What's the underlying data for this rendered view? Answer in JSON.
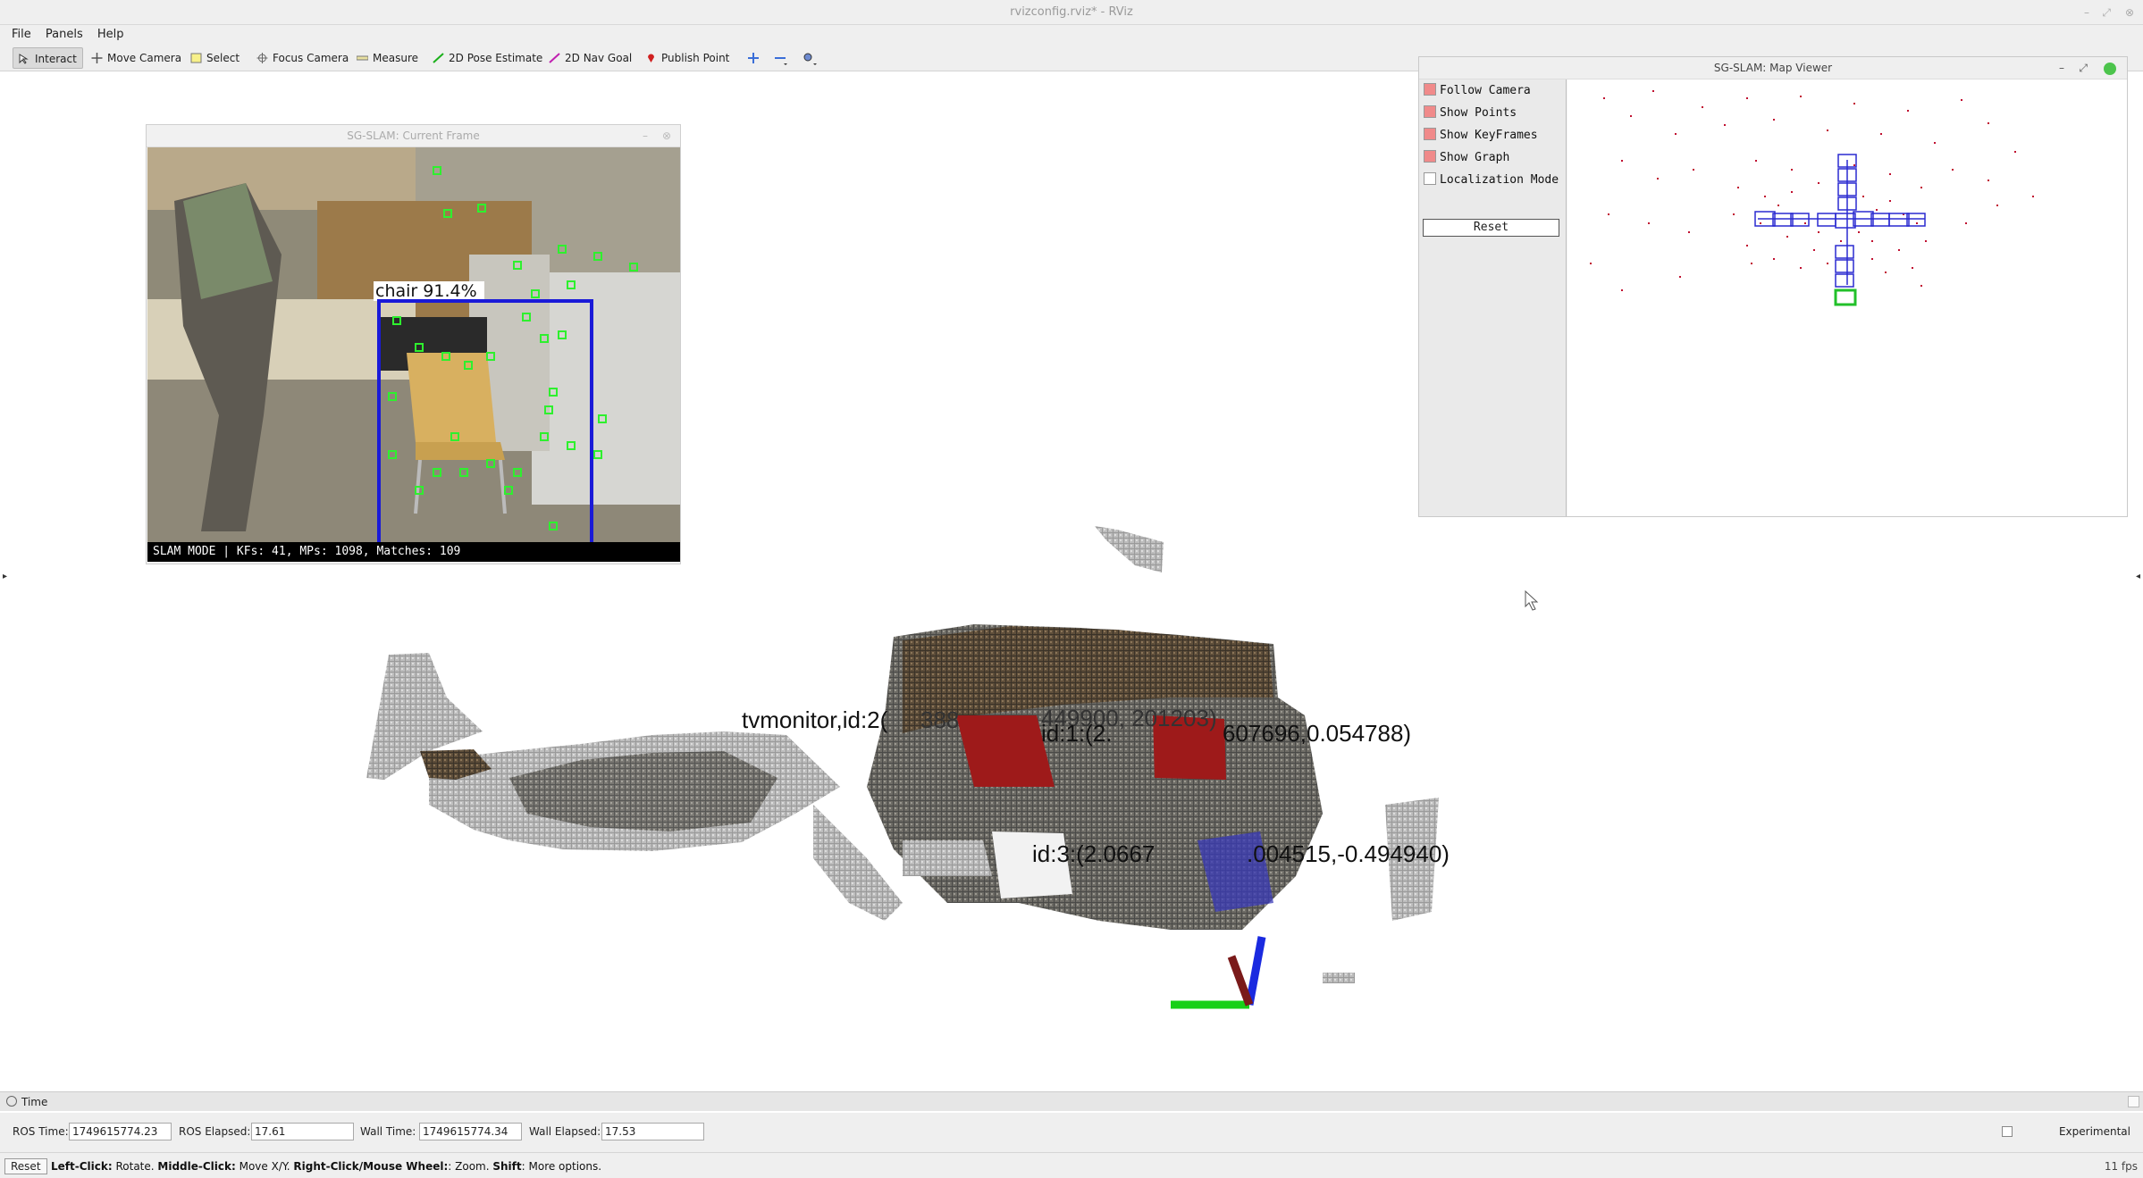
{
  "window": {
    "title": "rvizconfig.rviz* - RViz"
  },
  "menu": [
    {
      "label": "File"
    },
    {
      "label": "Panels"
    },
    {
      "label": "Help"
    }
  ],
  "toolbar": {
    "interact": "Interact",
    "move_camera": "Move Camera",
    "select": "Select",
    "focus_camera": "Focus Camera",
    "measure": "Measure",
    "pose_estimate": "2D Pose Estimate",
    "nav_goal": "2D Nav Goal",
    "publish_point": "Publish Point"
  },
  "current_frame": {
    "title": "SG-SLAM: Current Frame",
    "detection_label": "chair 91.4%",
    "status": "SLAM MODE |  KFs: 41, MPs: 1098, Matches: 109"
  },
  "map_viewer": {
    "title": "SG-SLAM: Map Viewer",
    "options": [
      {
        "label": "Follow Camera",
        "checked": true
      },
      {
        "label": "Show Points",
        "checked": true
      },
      {
        "label": "Show KeyFrames",
        "checked": true
      },
      {
        "label": "Show Graph",
        "checked": true
      },
      {
        "label": "Localization Mode",
        "checked": false
      }
    ],
    "reset": "Reset"
  },
  "scene_labels": {
    "tvmonitor": "tvmonitor,id:2(",
    "tvmonitor_mid": "388",
    "tvmonitor_end": "449900, 201203)",
    "id1_start": "id:1:(2.",
    "id1_end": "607696,0.054788)",
    "id3_start": "id:3:(2.0667",
    "id3_end": ".004515,-0.494940)"
  },
  "time_panel": {
    "header": "Time",
    "ros_time_label": "ROS Time:",
    "ros_time": "1749615774.23",
    "ros_elapsed_label": "ROS Elapsed:",
    "ros_elapsed": "17.61",
    "wall_time_label": "Wall Time:",
    "wall_time": "1749615774.34",
    "wall_elapsed_label": "Wall Elapsed:",
    "wall_elapsed": "17.53",
    "experimental": "Experimental"
  },
  "statusbar": {
    "reset": "Reset",
    "hint_b1": "Left-Click:",
    "hint_t1": " Rotate. ",
    "hint_b2": "Middle-Click:",
    "hint_t2": " Move X/Y. ",
    "hint_b3": "Right-Click/Mouse Wheel:",
    "hint_t3": ": Zoom. ",
    "hint_b4": "Shift",
    "hint_t4": ": More options.",
    "fps": "11 fps"
  },
  "colors": {
    "keyframe": "#2a2ad0",
    "point": "#c01030",
    "current_kf": "#22c02a",
    "bbox": "#1a1ad8"
  }
}
